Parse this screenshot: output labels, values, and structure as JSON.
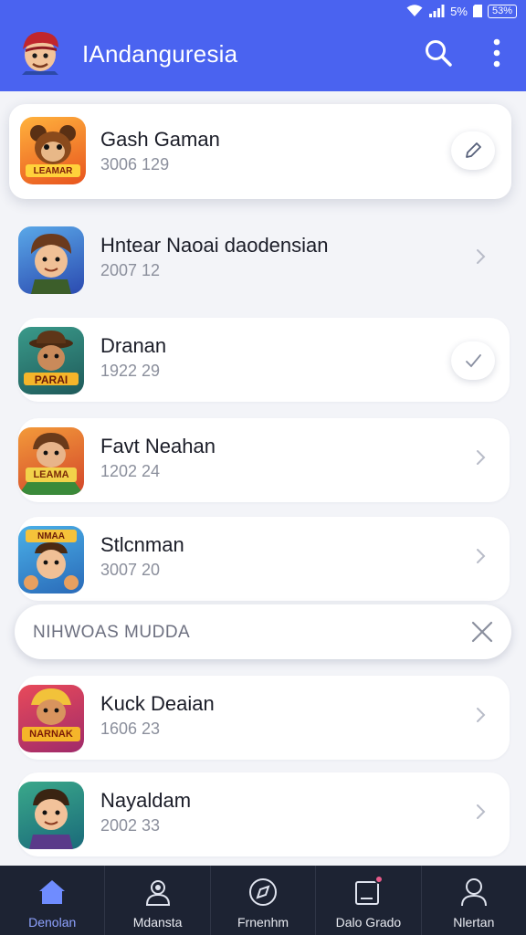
{
  "status_bar": {
    "signal_text": "5%",
    "battery_text": "53%"
  },
  "app_bar": {
    "title": "IAndanguresia"
  },
  "items": [
    {
      "title": "Gash Gaman",
      "subtitle": "3006 129",
      "action": "edit-icon",
      "thumb_label": "LEAMAR"
    },
    {
      "title": "Hntear Naoai daodensian",
      "subtitle": "2007 12",
      "action": "chevron-right-icon",
      "thumb_label": ""
    },
    {
      "title": "Dranan",
      "subtitle": "1922 29",
      "action": "check-icon",
      "thumb_label": "PARAI"
    },
    {
      "title": "Favt Neahan",
      "subtitle": "1202 24",
      "action": "chevron-right-icon",
      "thumb_label": "LEAMA"
    },
    {
      "title": "Stlcnman",
      "subtitle": "3007 20",
      "action": "chevron-right-icon",
      "thumb_label": "NMAA"
    },
    {
      "title": "Kuck Deaian",
      "subtitle": "1606 23",
      "action": "chevron-right-icon",
      "thumb_label": "NARNAK"
    },
    {
      "title": "Nayaldam",
      "subtitle": "2002 33",
      "action": "chevron-right-icon",
      "thumb_label": ""
    }
  ],
  "search_pill": {
    "text": "NIHWOAS MUDDA"
  },
  "bottom_nav": [
    {
      "label": "Denolan",
      "icon": "home-icon",
      "active": true
    },
    {
      "label": "Mdansta",
      "icon": "profile-badge-icon",
      "active": false
    },
    {
      "label": "Frnenhm",
      "icon": "compass-icon",
      "active": false
    },
    {
      "label": "Dalo Grado",
      "icon": "notification-card-icon",
      "active": false
    },
    {
      "label": "Nlertan",
      "icon": "user-icon",
      "active": false
    }
  ],
  "colors": {
    "primary": "#4a63f0",
    "nav_bg": "#1d2333",
    "accent_active": "#8ea2ff"
  }
}
